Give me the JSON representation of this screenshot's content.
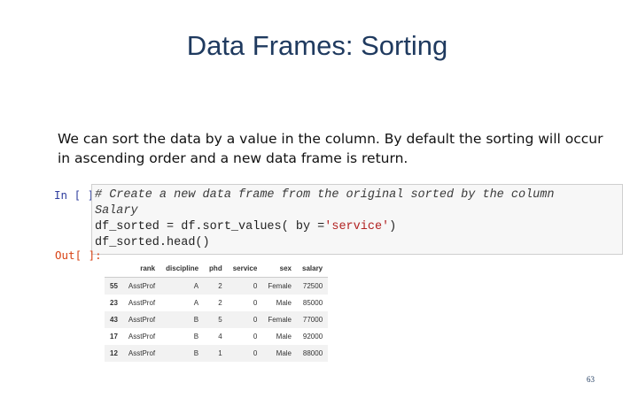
{
  "slide": {
    "title": "Data Frames: Sorting",
    "description": "We can sort the data by a value in the column. By default the sorting will occur in ascending order and a new data frame is return.",
    "page_number": "63"
  },
  "notebook": {
    "in_prompt": "In [ ]:",
    "out_prompt": "Out[ ]:",
    "code": {
      "comment_line1": "# Create a new data frame from the original sorted by the column",
      "comment_line2": "Salary",
      "line3_pre": "df_sorted = df.sort_values( by =",
      "line3_str": "'service'",
      "line3_post": ")",
      "line4": "df_sorted.head()"
    }
  },
  "dataframe": {
    "columns": [
      "",
      "rank",
      "discipline",
      "phd",
      "service",
      "sex",
      "salary"
    ],
    "rows": [
      [
        "55",
        "AsstProf",
        "A",
        "2",
        "0",
        "Female",
        "72500"
      ],
      [
        "23",
        "AsstProf",
        "A",
        "2",
        "0",
        "Male",
        "85000"
      ],
      [
        "43",
        "AsstProf",
        "B",
        "5",
        "0",
        "Female",
        "77000"
      ],
      [
        "17",
        "AsstProf",
        "B",
        "4",
        "0",
        "Male",
        "92000"
      ],
      [
        "12",
        "AsstProf",
        "B",
        "1",
        "0",
        "Male",
        "88000"
      ]
    ]
  }
}
